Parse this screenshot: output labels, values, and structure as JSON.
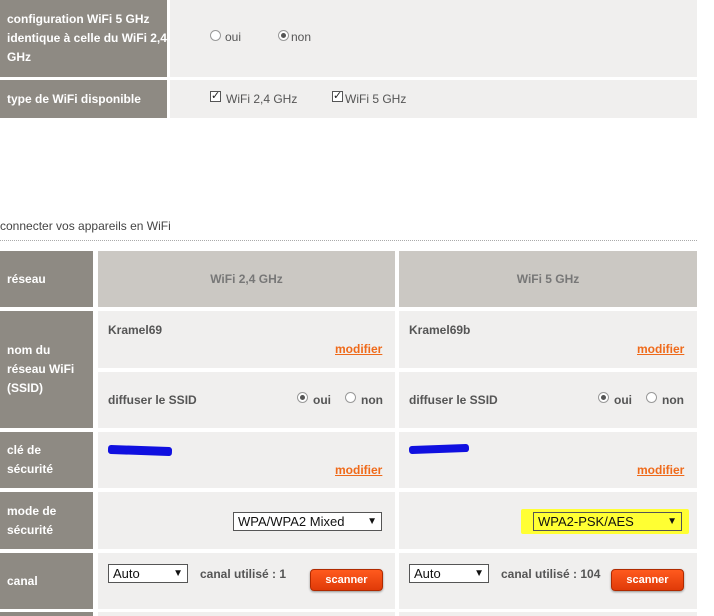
{
  "top": {
    "config_label": "configuration WiFi 5 GHz identique à celle du WiFi 2,4 GHz",
    "config_oui": "oui",
    "config_non": "non",
    "type_label": "type de WiFi disponible",
    "type_24": "WiFi 2,4 GHz",
    "type_5": "WiFi 5 GHz"
  },
  "section_title": "connecter vos appareils en WiFi",
  "table": {
    "reseau_label": "réseau",
    "col_24": "WiFi 2,4 GHz",
    "col_5": "WiFi 5 GHz",
    "ssid_label": "nom du réseau WiFi (SSID)",
    "ssid_24": "Kramel69",
    "ssid_5": "Kramel69b",
    "modifier": "modifier",
    "broadcast_label": "diffuser le SSID",
    "oui": "oui",
    "non": "non",
    "key_label": "clé de sécurité",
    "mode_label": "mode de sécurité",
    "mode_24": "WPA/WPA2 Mixed",
    "mode_5": "WPA2-PSK/AES",
    "canal_label": "canal",
    "canal_24_select": "Auto",
    "canal_5_select": "Auto",
    "canal_24_used": "canal utilisé : 1",
    "canal_5_used": "canal utilisé : 104",
    "scanner": "scanner",
    "highlight_color": "#ffff33"
  }
}
